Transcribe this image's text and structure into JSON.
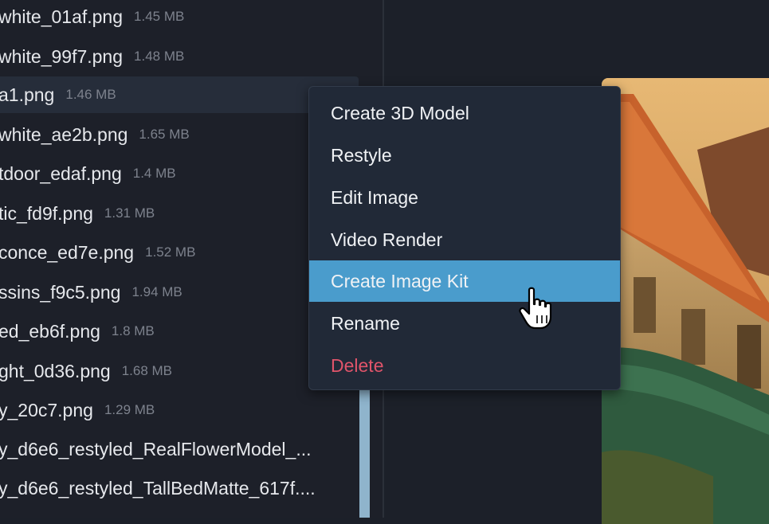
{
  "file_list": {
    "items": [
      {
        "name": "white_01af.png",
        "size": "1.45 MB"
      },
      {
        "name": "white_99f7.png",
        "size": "1.48 MB"
      },
      {
        "name": "a1.png",
        "size": "1.46 MB",
        "selected": true
      },
      {
        "name": "white_ae2b.png",
        "size": "1.65 MB"
      },
      {
        "name": "tdoor_edaf.png",
        "size": "1.4 MB"
      },
      {
        "name": "tic_fd9f.png",
        "size": "1.31 MB"
      },
      {
        "name": "conce_ed7e.png",
        "size": "1.52 MB"
      },
      {
        "name": "ssins_f9c5.png",
        "size": "1.94 MB"
      },
      {
        "name": "ed_eb6f.png",
        "size": "1.8 MB"
      },
      {
        "name": "ght_0d36.png",
        "size": "1.68 MB"
      },
      {
        "name": "y_20c7.png",
        "size": "1.29 MB"
      },
      {
        "name": "y_d6e6_restyled_RealFlowerModel_...",
        "size": ""
      },
      {
        "name": "y_d6e6_restyled_TallBedMatte_617f....",
        "size": ""
      }
    ]
  },
  "context_menu": {
    "items": [
      {
        "label": "Create 3D Model"
      },
      {
        "label": "Restyle"
      },
      {
        "label": "Edit Image"
      },
      {
        "label": "Video Render"
      },
      {
        "label": "Create Image Kit",
        "hovered": true
      },
      {
        "label": "Rename"
      },
      {
        "label": "Delete",
        "danger": true
      }
    ]
  },
  "colors": {
    "menu_hover": "#4a9ccc",
    "danger": "#e0546a",
    "panel_bg": "#1d2029"
  }
}
